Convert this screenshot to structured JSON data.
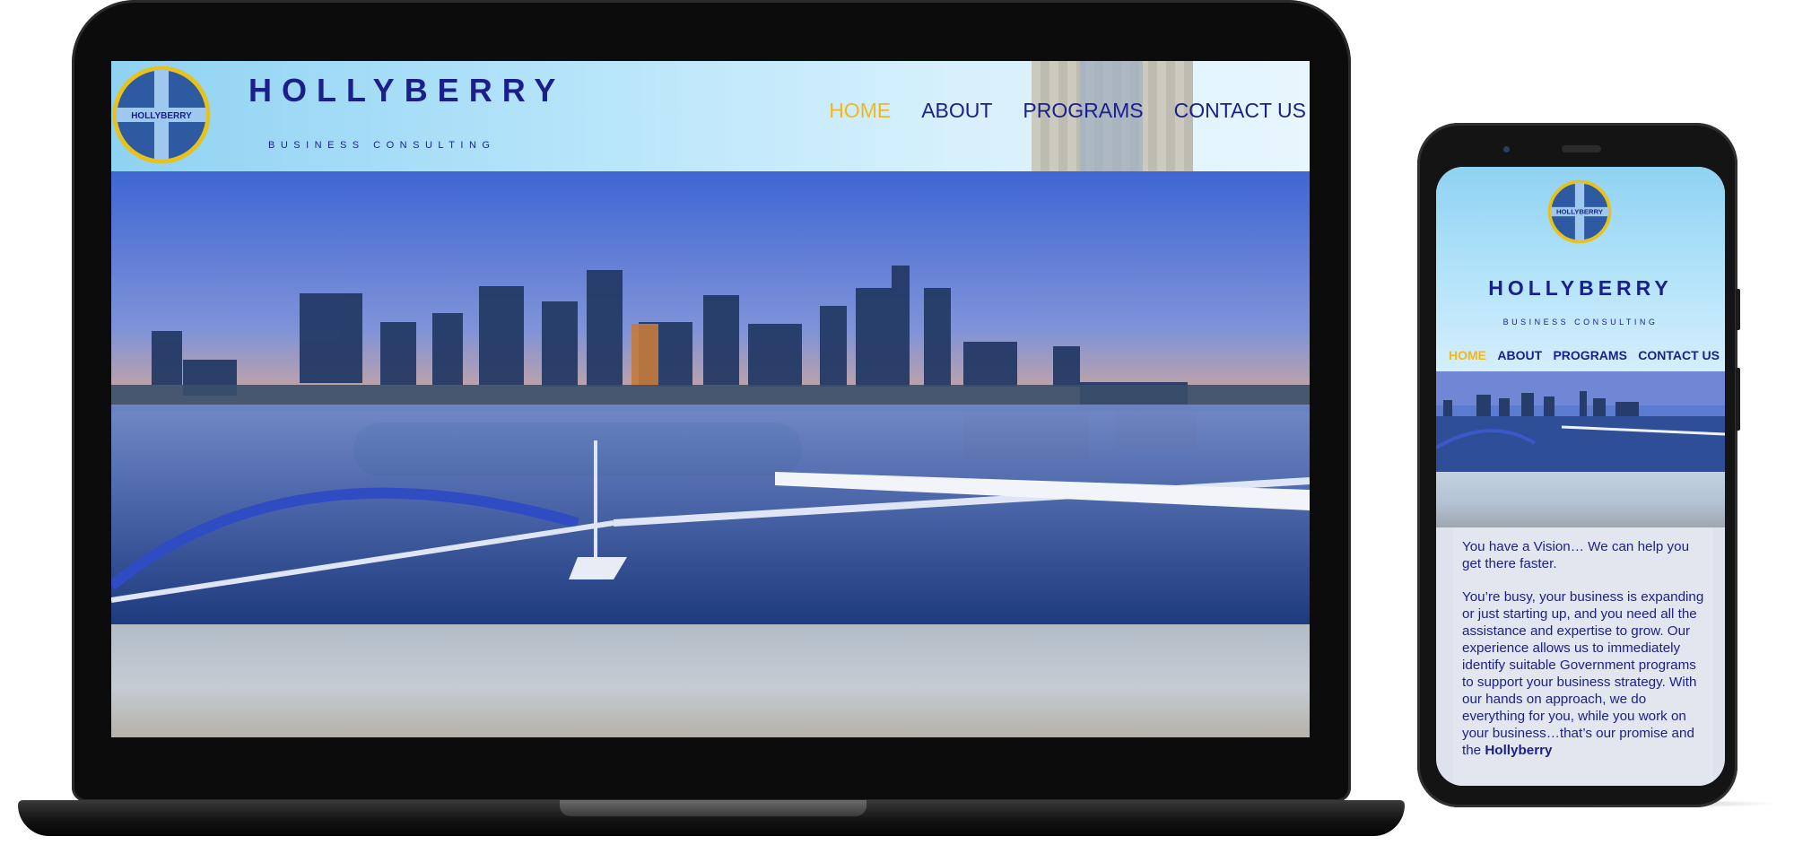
{
  "site": {
    "brand_name": "HOLLYBERRY",
    "tagline": "BUSINESS CONSULTING",
    "logo_text": "HOLLYBERRY",
    "colors": {
      "brand_navy": "#1a1f8c",
      "nav_active": "#f1b81d",
      "logo_blue": "#2d5aa0",
      "logo_ring": "#e8c21c"
    },
    "nav": [
      {
        "label": "HOME",
        "active": true
      },
      {
        "label": "ABOUT",
        "active": false
      },
      {
        "label": "PROGRAMS",
        "active": false
      },
      {
        "label": "CONTACT US",
        "active": false
      }
    ]
  },
  "mobile": {
    "intro_paragraph": "You have a Vision… We can help you get there faster.",
    "body_paragraph_text": "You’re busy, your business is expanding or just starting up, and you need all the assistance and expertise to grow. Our experience allows us to immediately identify suitable Government programs to support your business strategy. With our hands on approach, we do everything for you, while you work on your business…that’s our promise and the ",
    "body_paragraph_bold": "Hollyberry"
  },
  "devices": {
    "laptop_icon": "laptop-icon",
    "phone_icon": "smartphone-icon"
  }
}
